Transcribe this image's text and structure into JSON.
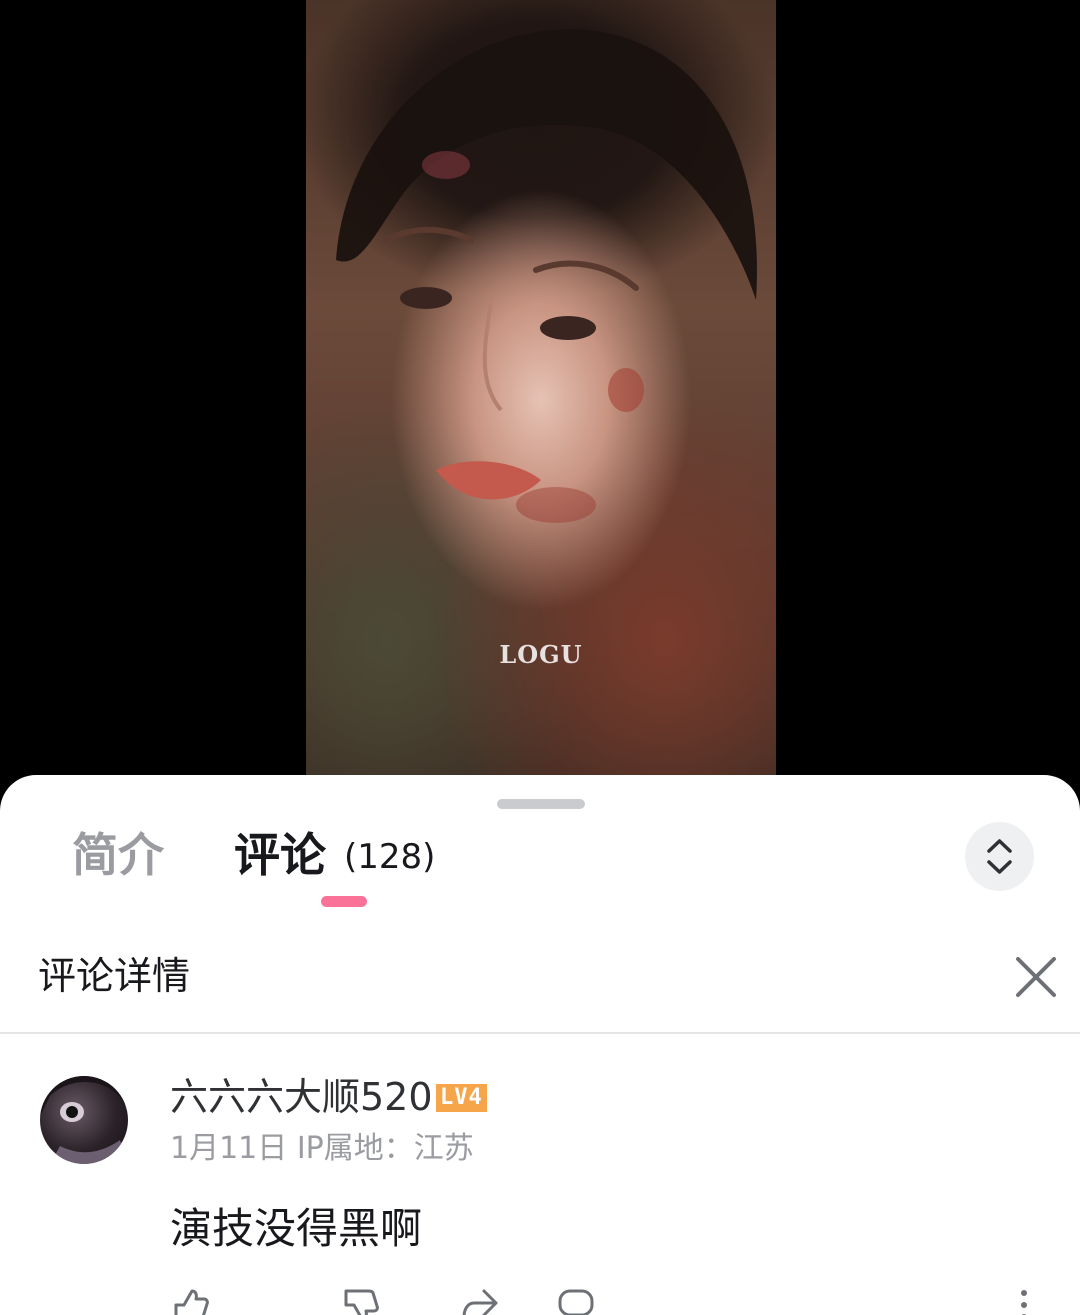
{
  "video": {
    "watermark": "LOGU"
  },
  "tabs": {
    "intro_label": "简介",
    "comments_label": "评论",
    "comments_count": "(128)"
  },
  "detail": {
    "title": "评论详情"
  },
  "comment": {
    "username": "六六六大顺520",
    "level": "LV4",
    "date": "1月11日",
    "ip_location": "IP属地：江苏",
    "text": "演技没得黑啊"
  },
  "icons": {
    "expand": "chevron-up-down-icon",
    "close": "close-icon",
    "like": "thumbs-up-icon",
    "dislike": "thumbs-down-icon",
    "share": "share-icon",
    "reply": "reply-icon",
    "more": "more-icon"
  },
  "colors": {
    "accent_pink": "#fb7299",
    "level_badge": "#f6a54a",
    "text_primary": "#18191c",
    "text_secondary": "#9a9ca1"
  }
}
